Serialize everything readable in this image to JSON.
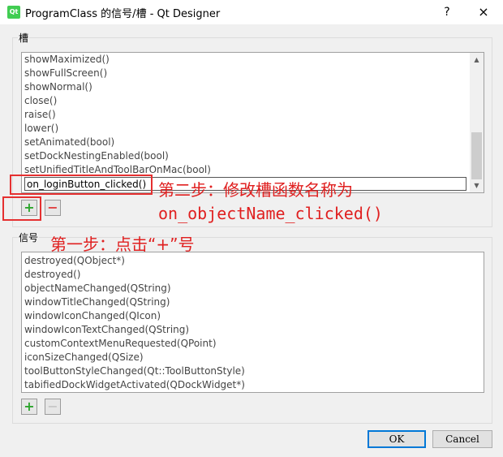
{
  "window": {
    "title": "ProgramClass 的信号/槽 - Qt Designer",
    "app_icon_label": "Qt",
    "help_label": "?",
    "close_label": "×"
  },
  "slots_group": {
    "label": "槽",
    "items": [
      "showMaximized()",
      "showFullScreen()",
      "showNormal()",
      "close()",
      "raise()",
      "lower()",
      "setAnimated(bool)",
      "setDockNestingEnabled(bool)",
      "setUnifiedTitleAndToolBarOnMac(bool)"
    ],
    "edit_value": "on_loginButton_clicked()",
    "add_label": "+",
    "remove_label": "−"
  },
  "signals_group": {
    "label": "信号",
    "items": [
      "destroyed(QObject*)",
      "destroyed()",
      "objectNameChanged(QString)",
      "windowTitleChanged(QString)",
      "windowIconChanged(QIcon)",
      "windowIconTextChanged(QString)",
      "customContextMenuRequested(QPoint)",
      "iconSizeChanged(QSize)",
      "toolButtonStyleChanged(Qt::ToolButtonStyle)",
      "tabifiedDockWidgetActivated(QDockWidget*)"
    ],
    "add_label": "+",
    "remove_label": "−"
  },
  "annotations": {
    "step2_line1": "第二步：修改槽函数名称为",
    "step2_line2": "on_objectName_clicked()",
    "step1": "第一步：点击“+”号"
  },
  "buttons": {
    "ok": "OK",
    "cancel": "Cancel"
  },
  "colors": {
    "annotation_red": "#e02020",
    "focus_blue": "#0078d7",
    "add_green": "#2da52d"
  },
  "icons": {
    "app": "qt-logo-icon",
    "add": "plus-icon",
    "remove": "minus-icon",
    "scroll_up": "chevron-up-icon",
    "scroll_down": "chevron-down-icon"
  }
}
